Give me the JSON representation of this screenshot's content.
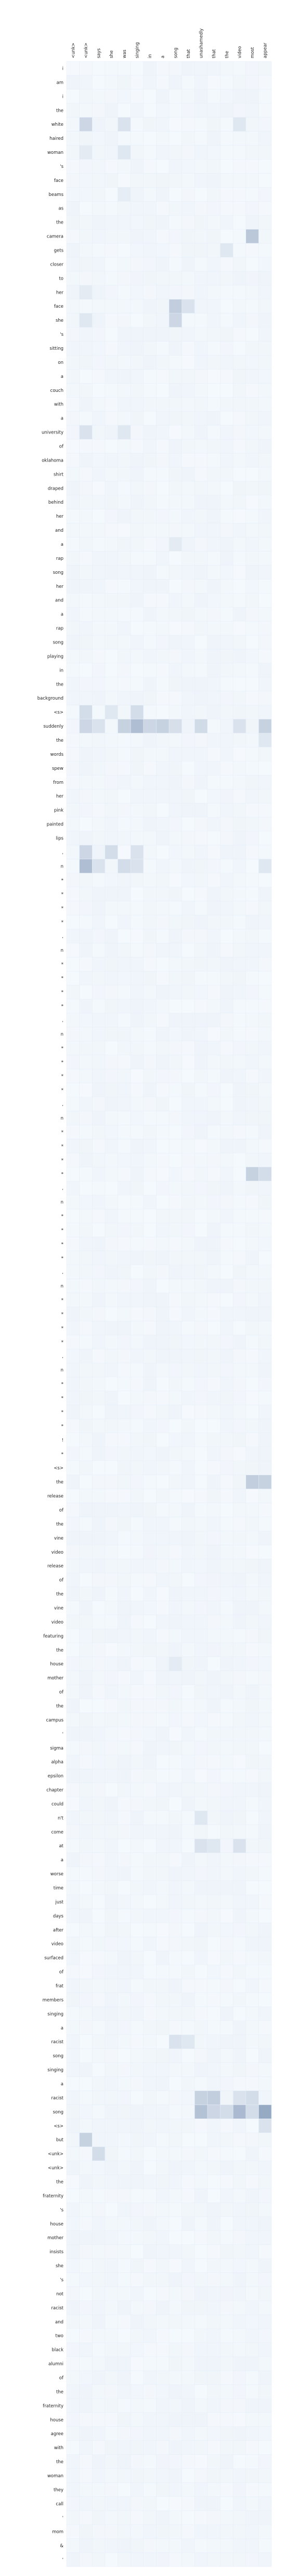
{
  "chart_data": {
    "type": "heatmap",
    "title": "",
    "xlabel": "",
    "ylabel": "",
    "colormap": "Blues",
    "x_tokens": [
      "<unk>",
      "<unk>",
      "says",
      "she",
      "was",
      "singing",
      "in",
      "a",
      "song",
      "that",
      "unashamedly",
      "that",
      "the",
      "video",
      "most",
      "appear"
    ],
    "y_tokens": [
      "i",
      "am",
      "i",
      "the",
      "white",
      "haired",
      "woman",
      "'s",
      "face",
      "beams",
      "as",
      "the",
      "camera",
      "gets",
      "closer",
      "to",
      "her",
      "face",
      "she",
      "'s",
      "sitting",
      "on",
      "a",
      "couch",
      "with",
      "a",
      "university",
      "of",
      "oklahoma",
      "shirt",
      "draped",
      "behind",
      "her",
      "and",
      "a",
      "rap",
      "song",
      "her",
      "and",
      "a",
      "rap",
      "song",
      "playing",
      "in",
      "the",
      "background",
      "<s>",
      "suddenly",
      "the",
      "words",
      "spew",
      "from",
      "her",
      "pink",
      "painted",
      "lips",
      ",",
      "n",
      "*",
      "*",
      "*",
      "*",
      ",",
      "n",
      "*",
      "*",
      "*",
      "*",
      ",",
      "n",
      "*",
      "*",
      "*",
      "*",
      ",",
      "n",
      "*",
      "*",
      "*",
      "*",
      ",",
      "n",
      "*",
      "*",
      "*",
      "*",
      ",",
      "n",
      "*",
      "*",
      "*",
      "*",
      ",",
      "n",
      "*",
      "*",
      "*",
      "*",
      "!",
      "*",
      "<s>",
      "the",
      "release",
      "of",
      "the",
      "vine",
      "video",
      "release",
      "of",
      "the",
      "vine",
      "video",
      "featuring",
      "the",
      "house",
      "mother",
      "of",
      "the",
      "campus",
      "'",
      "sigma",
      "alpha",
      "epsilon",
      "chapter",
      "could",
      "n't",
      "come",
      "at",
      "a",
      "worse",
      "time",
      "just",
      "days",
      "after",
      "video",
      "surfaced",
      "of",
      "frat",
      "members",
      "singing",
      "a",
      "racist",
      "song",
      "singing",
      "a",
      "racist",
      "song",
      "<s>",
      "but",
      "<unk>",
      "<unk>",
      "the",
      "fraternity",
      "'s",
      "house",
      "mother",
      "insists",
      "she",
      "'s",
      "not",
      "racist",
      "and",
      "two",
      "black",
      "alumni",
      "of",
      "the",
      "fraternity",
      "house",
      "agree",
      "with",
      "the",
      "woman",
      "they",
      "call",
      "'",
      "mom",
      "&",
      "'"
    ],
    "hot_cells": [
      {
        "row": 4,
        "col": 1,
        "value": 0.18
      },
      {
        "row": 4,
        "col": 4,
        "value": 0.12
      },
      {
        "row": 4,
        "col": 13,
        "value": 0.1
      },
      {
        "row": 6,
        "col": 1,
        "value": 0.08
      },
      {
        "row": 6,
        "col": 4,
        "value": 0.1
      },
      {
        "row": 9,
        "col": 4,
        "value": 0.07
      },
      {
        "row": 12,
        "col": 14,
        "value": 0.25
      },
      {
        "row": 13,
        "col": 12,
        "value": 0.1
      },
      {
        "row": 16,
        "col": 1,
        "value": 0.08
      },
      {
        "row": 17,
        "col": 8,
        "value": 0.22
      },
      {
        "row": 17,
        "col": 9,
        "value": 0.12
      },
      {
        "row": 18,
        "col": 8,
        "value": 0.18
      },
      {
        "row": 18,
        "col": 1,
        "value": 0.1
      },
      {
        "row": 26,
        "col": 1,
        "value": 0.12
      },
      {
        "row": 26,
        "col": 4,
        "value": 0.1
      },
      {
        "row": 34,
        "col": 8,
        "value": 0.08
      },
      {
        "row": 46,
        "col": 1,
        "value": 0.15
      },
      {
        "row": 46,
        "col": 3,
        "value": 0.1
      },
      {
        "row": 46,
        "col": 5,
        "value": 0.15
      },
      {
        "row": 47,
        "col": 1,
        "value": 0.18
      },
      {
        "row": 47,
        "col": 2,
        "value": 0.12
      },
      {
        "row": 47,
        "col": 4,
        "value": 0.2
      },
      {
        "row": 47,
        "col": 5,
        "value": 0.3
      },
      {
        "row": 47,
        "col": 6,
        "value": 0.18
      },
      {
        "row": 47,
        "col": 7,
        "value": 0.2
      },
      {
        "row": 47,
        "col": 8,
        "value": 0.14
      },
      {
        "row": 47,
        "col": 10,
        "value": 0.16
      },
      {
        "row": 47,
        "col": 13,
        "value": 0.12
      },
      {
        "row": 47,
        "col": 15,
        "value": 0.2
      },
      {
        "row": 48,
        "col": 15,
        "value": 0.1
      },
      {
        "row": 56,
        "col": 1,
        "value": 0.18
      },
      {
        "row": 56,
        "col": 3,
        "value": 0.15
      },
      {
        "row": 56,
        "col": 5,
        "value": 0.12
      },
      {
        "row": 57,
        "col": 1,
        "value": 0.3
      },
      {
        "row": 57,
        "col": 2,
        "value": 0.12
      },
      {
        "row": 57,
        "col": 4,
        "value": 0.15
      },
      {
        "row": 57,
        "col": 5,
        "value": 0.12
      },
      {
        "row": 57,
        "col": 15,
        "value": 0.1
      },
      {
        "row": 79,
        "col": 14,
        "value": 0.2
      },
      {
        "row": 79,
        "col": 15,
        "value": 0.15
      },
      {
        "row": 101,
        "col": 14,
        "value": 0.22
      },
      {
        "row": 101,
        "col": 15,
        "value": 0.2
      },
      {
        "row": 114,
        "col": 8,
        "value": 0.08
      },
      {
        "row": 125,
        "col": 10,
        "value": 0.1
      },
      {
        "row": 127,
        "col": 10,
        "value": 0.12
      },
      {
        "row": 127,
        "col": 11,
        "value": 0.1
      },
      {
        "row": 127,
        "col": 13,
        "value": 0.12
      },
      {
        "row": 141,
        "col": 8,
        "value": 0.12
      },
      {
        "row": 141,
        "col": 9,
        "value": 0.1
      },
      {
        "row": 145,
        "col": 10,
        "value": 0.2
      },
      {
        "row": 145,
        "col": 11,
        "value": 0.22
      },
      {
        "row": 145,
        "col": 13,
        "value": 0.12
      },
      {
        "row": 145,
        "col": 14,
        "value": 0.15
      },
      {
        "row": 146,
        "col": 10,
        "value": 0.28
      },
      {
        "row": 146,
        "col": 11,
        "value": 0.18
      },
      {
        "row": 146,
        "col": 12,
        "value": 0.15
      },
      {
        "row": 146,
        "col": 13,
        "value": 0.32
      },
      {
        "row": 146,
        "col": 14,
        "value": 0.15
      },
      {
        "row": 146,
        "col": 15,
        "value": 0.4
      },
      {
        "row": 147,
        "col": 15,
        "value": 0.12
      },
      {
        "row": 148,
        "col": 1,
        "value": 0.2
      },
      {
        "row": 149,
        "col": 2,
        "value": 0.15
      }
    ],
    "grid": true,
    "legend": "none"
  }
}
